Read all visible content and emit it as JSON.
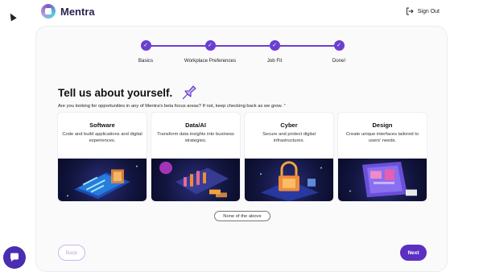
{
  "app": {
    "name": "Mentra"
  },
  "header": {
    "signout_label": "Sign Out"
  },
  "stepper": {
    "steps": [
      {
        "label": "Basics",
        "done": true
      },
      {
        "label": "Workplace Preferences",
        "done": true
      },
      {
        "label": "Job Fit",
        "done": true
      },
      {
        "label": "Done!",
        "done": true
      }
    ]
  },
  "main": {
    "title": "Tell us about yourself.",
    "question": "Are you looking for opportunities in any of Mentra's beta focus areas? If not, keep checking back as we grow.",
    "required_mark": "*",
    "options": [
      {
        "title": "Software",
        "description": "Code and build applications and digital experiences.",
        "icon": "software-illustration"
      },
      {
        "title": "Data/AI",
        "description": "Transform data insights into business strategies.",
        "icon": "data-ai-illustration"
      },
      {
        "title": "Cyber",
        "description": "Secure and protect digital infrastructures.",
        "icon": "cyber-lock-illustration"
      },
      {
        "title": "Design",
        "description": "Create unique interfaces tailored to users' needs.",
        "icon": "design-illustration"
      }
    ],
    "none_label": "None of the above"
  },
  "footer": {
    "back_label": "Back",
    "next_label": "Next"
  },
  "colors": {
    "accent": "#5b2fc2",
    "step": "#6a3fd0",
    "back_border": "#c9b6ef",
    "required": "#d32f2f"
  }
}
